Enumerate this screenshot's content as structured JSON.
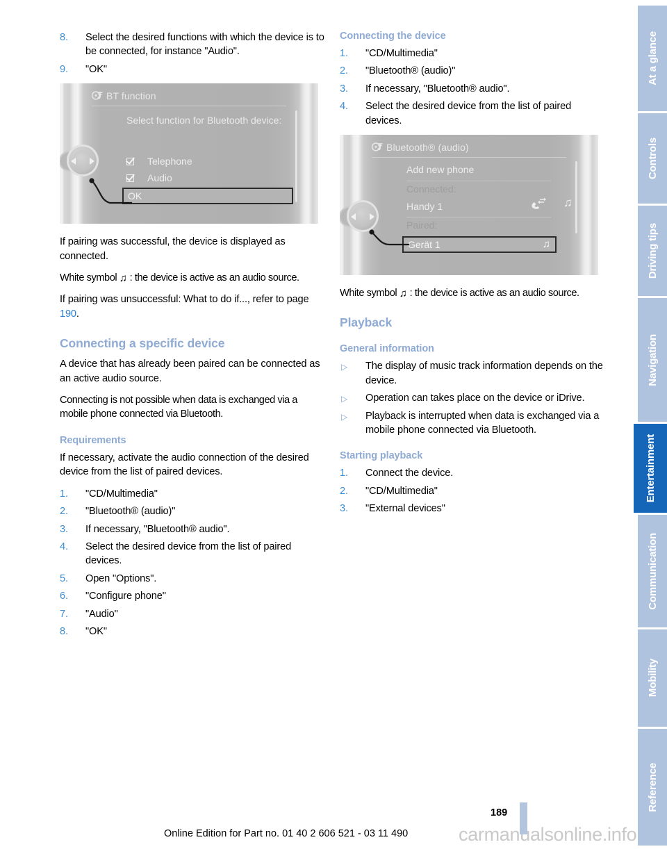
{
  "document": {
    "page_number": "189",
    "footer_note": "Online Edition for Part no. 01 40 2 606 521 - 03 11 490",
    "watermark": "carmanualsonline.info"
  },
  "colors": {
    "heading_blue": "#8fabd4",
    "number_blue": "#3f8ed0",
    "link_blue": "#2a7fd4",
    "tab_inactive": "#afc2de",
    "tab_active": "#1565b8"
  },
  "left_column": {
    "steps_top": [
      {
        "num": "8.",
        "text": "Select the desired functions with which the device is to be connected, for instance \"Audio\"."
      },
      {
        "num": "9.",
        "text": "\"OK\""
      }
    ],
    "figure": {
      "title": "BT function",
      "title_icon": "cd-multimedia-icon",
      "prompt": "Select function for Bluetooth device:",
      "options": [
        {
          "label": "Telephone",
          "checked": true
        },
        {
          "label": "Audio",
          "checked": true
        }
      ],
      "confirm_button": "OK",
      "controller_icon": "idrive-controller-icon"
    },
    "paragraphs": [
      "If pairing was successful, the device is displayed as connected.",
      "source.",
      "If pairing was unsuccessful: What to do if..., refer"
    ],
    "white_symbol_prefix": "White symbol",
    "white_symbol_glyph": "♫",
    "white_symbol_suffix": ": the device is active as an audio source.",
    "unsuccessful_prefix": "If pairing was unsuccessful: What to do if..., refer to page",
    "unsuccessful_pageref": "190",
    "unsuccessful_suffix": ".",
    "section_connecting_specific": {
      "heading": "Connecting a specific device",
      "paragraphs": [
        "A device that has already been paired can be connected as an active audio source.",
        "Connecting is not possible when data is exchanged via a mobile phone connected via Bluetooth."
      ]
    },
    "section_requirements": {
      "heading": "Requirements",
      "intro": "If necessary, activate the audio connection of the desired device from the list of paired devices.",
      "steps": [
        {
          "num": "1.",
          "text": "\"CD/Multimedia\""
        },
        {
          "num": "2.",
          "text": "\"Bluetooth® (audio)\""
        },
        {
          "num": "3.",
          "text": "If necessary, \"Bluetooth® audio\"."
        },
        {
          "num": "4.",
          "text": "Select the desired device from the list of paired devices."
        },
        {
          "num": "5.",
          "text": "Open \"Options\"."
        },
        {
          "num": "6.",
          "text": "\"Configure phone\""
        },
        {
          "num": "7.",
          "text": "\"Audio\""
        },
        {
          "num": "8.",
          "text": "\"OK\""
        }
      ]
    }
  },
  "right_column": {
    "section_connecting_device": {
      "heading": "Connecting the device",
      "steps": [
        {
          "num": "1.",
          "text": "\"CD/Multimedia\""
        },
        {
          "num": "2.",
          "text": "\"Bluetooth® (audio)\""
        },
        {
          "num": "3.",
          "text": "If necessary, \"Bluetooth® audio\"."
        },
        {
          "num": "4.",
          "text": "Select the desired device from the list of paired devices."
        }
      ]
    },
    "figure": {
      "title": "Bluetooth® (audio)",
      "title_icon": "cd-multimedia-icon",
      "add_entry": "Add new phone",
      "connected_label": "Connected:",
      "connected_device": "Handy 1",
      "connected_icons": [
        "phone-handset-icon",
        "music-note-icon"
      ],
      "paired_label": "Paired:",
      "paired_device": "Gerät 1",
      "paired_icon": "music-note-icon",
      "controller_icon": "idrive-controller-icon"
    },
    "white_symbol_prefix": "White symbol",
    "white_symbol_glyph": "♫",
    "white_symbol_suffix": ": the device is active as an audio source.",
    "section_playback": {
      "heading": "Playback",
      "general_heading": "General information",
      "bullets": [
        "The display of music track information depends on the device.",
        "Operation can takes place on the device or iDrive.",
        "Playback is interrupted when data is exchanged via a mobile phone connected via Bluetooth."
      ],
      "starting_heading": "Starting playback",
      "starting_steps": [
        {
          "num": "1.",
          "text": "Connect the device."
        },
        {
          "num": "2.",
          "text": "\"CD/Multimedia\""
        },
        {
          "num": "3.",
          "text": "\"External devices\""
        }
      ]
    }
  },
  "sidebar": {
    "tabs": [
      {
        "label": "At a glance",
        "active": false
      },
      {
        "label": "Controls",
        "active": false
      },
      {
        "label": "Driving tips",
        "active": false
      },
      {
        "label": "Navigation",
        "active": false
      },
      {
        "label": "Entertainment",
        "active": true
      },
      {
        "label": "Communication",
        "active": false
      },
      {
        "label": "Mobility",
        "active": false
      },
      {
        "label": "Reference",
        "active": false
      }
    ]
  }
}
